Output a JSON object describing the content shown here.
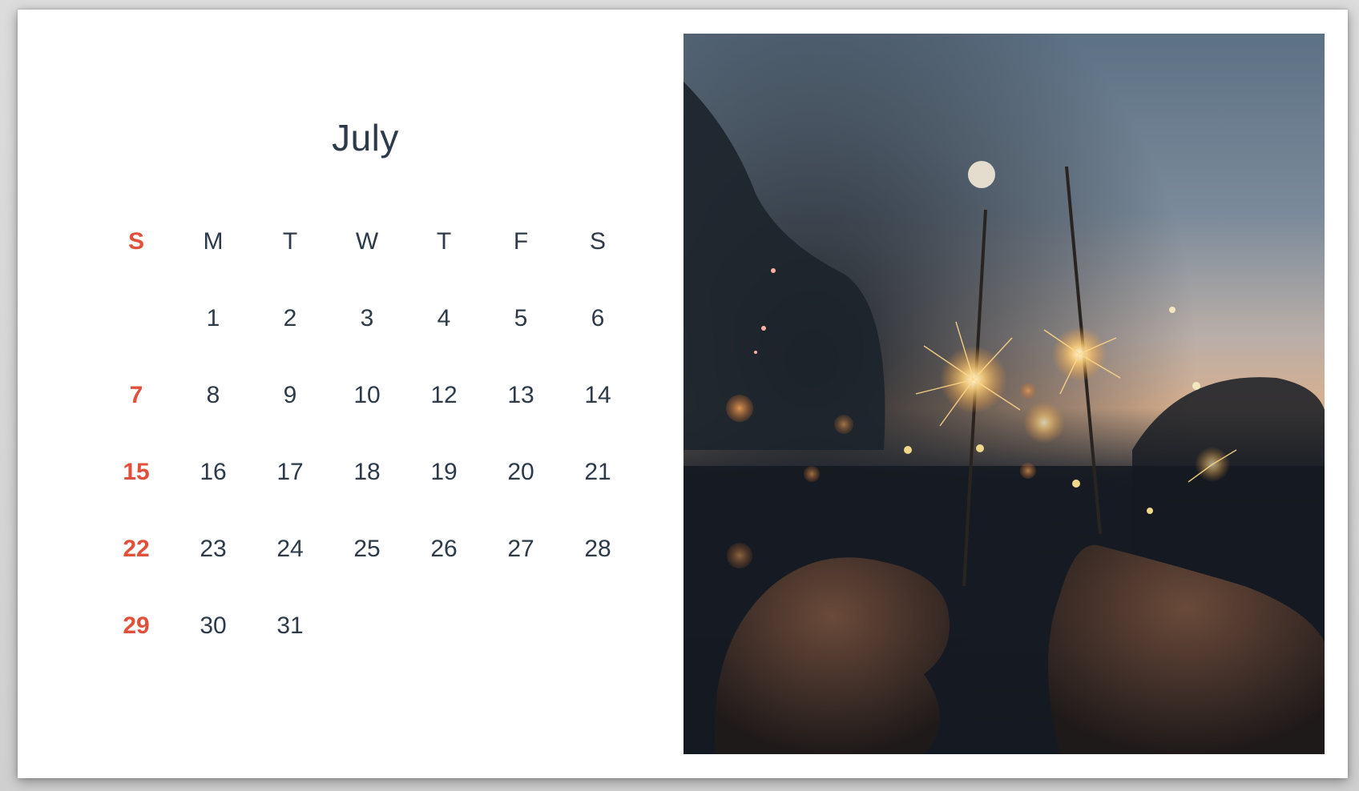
{
  "calendar": {
    "month": "July",
    "weekdays": [
      "S",
      "M",
      "T",
      "W",
      "T",
      "F",
      "S"
    ],
    "weeks": [
      [
        "",
        "1",
        "2",
        "3",
        "4",
        "5",
        "6"
      ],
      [
        "7",
        "8",
        "9",
        "10",
        "12",
        "13",
        "14"
      ],
      [
        "15",
        "16",
        "17",
        "18",
        "19",
        "20",
        "21"
      ],
      [
        "22",
        "23",
        "24",
        "25",
        "26",
        "27",
        "28"
      ],
      [
        "29",
        "30",
        "31",
        "",
        "",
        "",
        ""
      ]
    ],
    "sunday_color": "#e0503a",
    "text_color": "#2d3a4a"
  },
  "photo": {
    "subject": "sparklers-photo"
  }
}
